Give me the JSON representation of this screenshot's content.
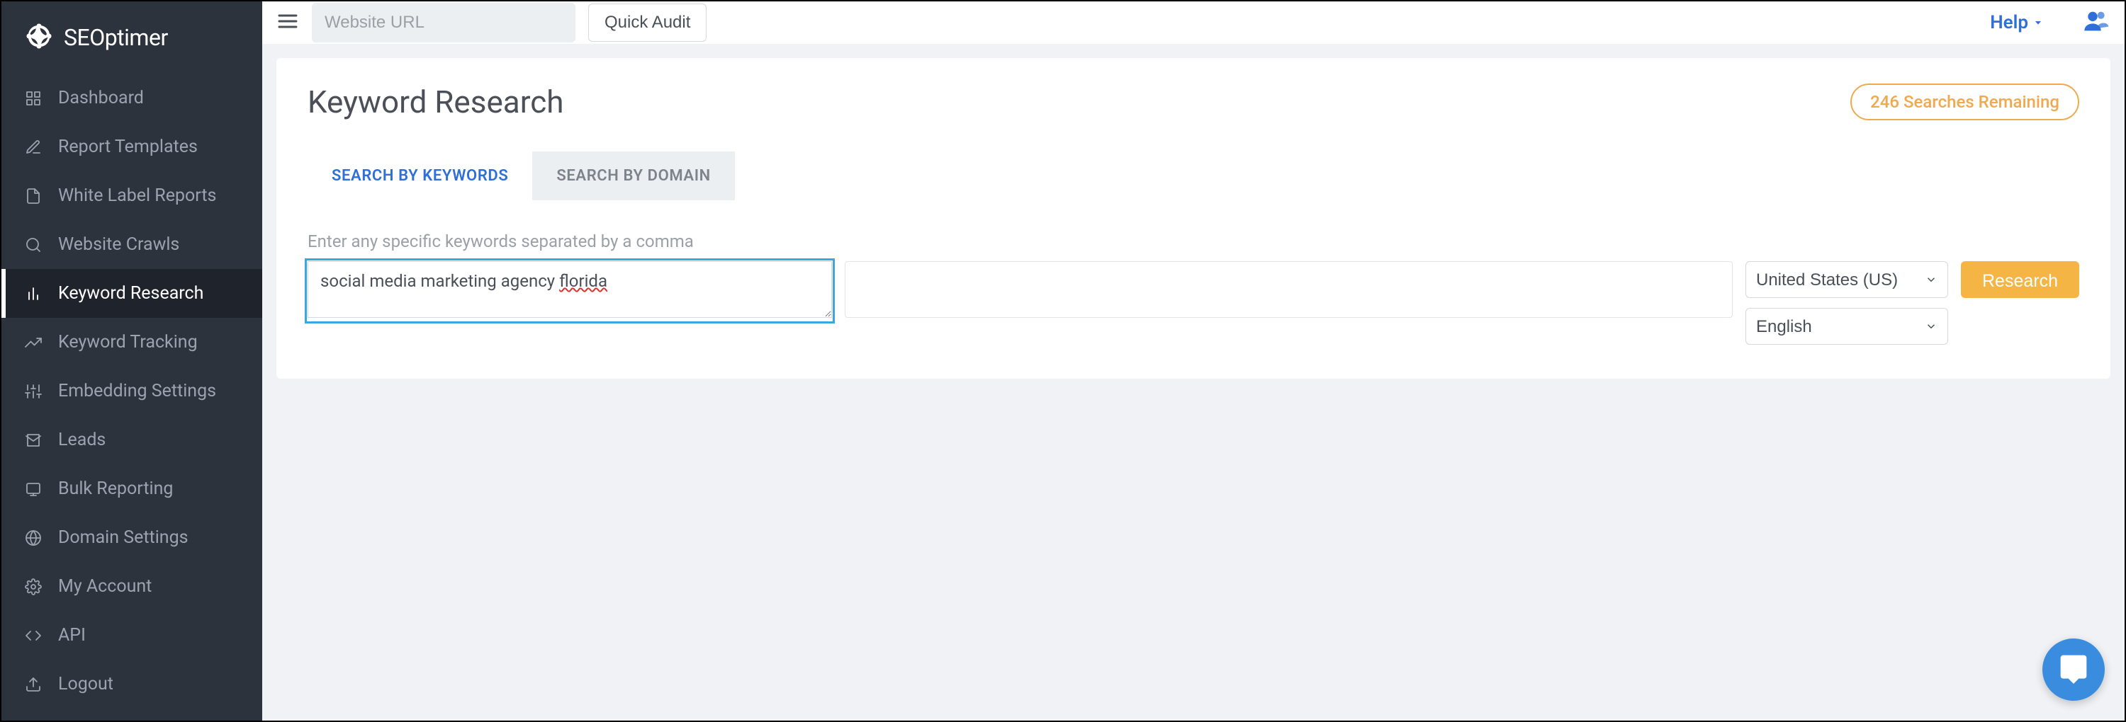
{
  "brand": {
    "name": "SEOptimer"
  },
  "topbar": {
    "url_placeholder": "Website URL",
    "quick_audit": "Quick Audit",
    "help": "Help"
  },
  "sidebar": {
    "items": [
      {
        "label": "Dashboard",
        "icon": "dashboard-icon"
      },
      {
        "label": "Report Templates",
        "icon": "report-templates-icon"
      },
      {
        "label": "White Label Reports",
        "icon": "white-label-icon"
      },
      {
        "label": "Website Crawls",
        "icon": "crawls-icon"
      },
      {
        "label": "Keyword Research",
        "icon": "keyword-research-icon"
      },
      {
        "label": "Keyword Tracking",
        "icon": "keyword-tracking-icon"
      },
      {
        "label": "Embedding Settings",
        "icon": "embedding-icon"
      },
      {
        "label": "Leads",
        "icon": "leads-icon"
      },
      {
        "label": "Bulk Reporting",
        "icon": "bulk-reporting-icon"
      },
      {
        "label": "Domain Settings",
        "icon": "domain-settings-icon"
      },
      {
        "label": "My Account",
        "icon": "account-icon"
      },
      {
        "label": "API",
        "icon": "api-icon"
      },
      {
        "label": "Logout",
        "icon": "logout-icon"
      }
    ],
    "active_index": 4
  },
  "page": {
    "title": "Keyword Research",
    "searches_remaining": "246 Searches Remaining",
    "tabs": [
      {
        "label": "SEARCH BY KEYWORDS",
        "active": true
      },
      {
        "label": "SEARCH BY DOMAIN",
        "active": false
      }
    ],
    "hint": "Enter any specific keywords separated by a comma",
    "keyword_value_prefix": "social media marketing agency ",
    "keyword_value_spell": "florida",
    "country_select": "United States (US)",
    "language_select": "English",
    "research_button": "Research"
  }
}
